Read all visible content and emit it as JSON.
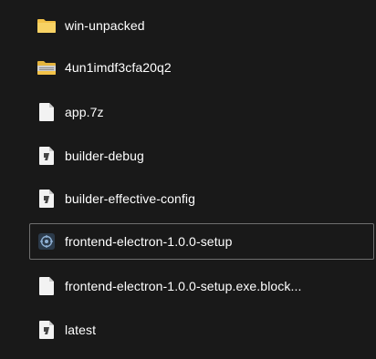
{
  "items": [
    {
      "label": "win-unpacked",
      "icon": "folder-icon"
    },
    {
      "label": "4un1imdf3cfa20q2",
      "icon": "folder-icon"
    },
    {
      "label": "app.7z",
      "icon": "file-icon"
    },
    {
      "label": "builder-debug",
      "icon": "text-file-icon"
    },
    {
      "label": "builder-effective-config",
      "icon": "text-file-icon"
    },
    {
      "label": "frontend-electron-1.0.0-setup",
      "icon": "installer-app-icon"
    },
    {
      "label": "frontend-electron-1.0.0-setup.exe.block...",
      "icon": "file-icon"
    },
    {
      "label": "latest",
      "icon": "text-file-icon"
    }
  ],
  "colors": {
    "background": "#191919",
    "text": "#ffffff",
    "folder": "#f3c248",
    "selection_border": "#6f6f6f"
  }
}
